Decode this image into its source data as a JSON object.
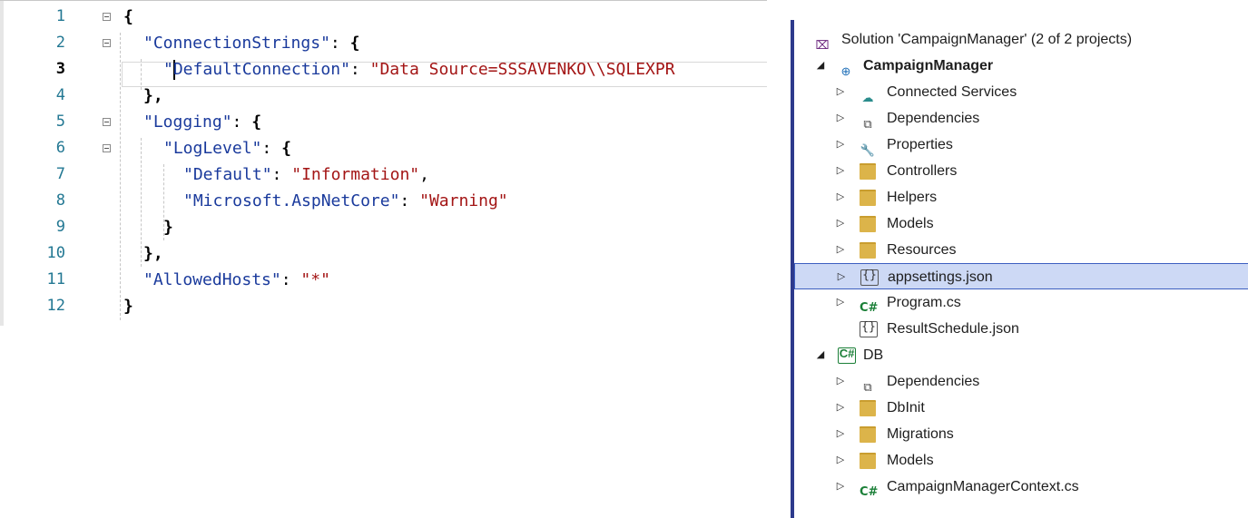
{
  "editor": {
    "lines": [
      {
        "num": "1",
        "tokens": [
          {
            "t": "{",
            "c": "b"
          }
        ]
      },
      {
        "num": "2",
        "tokens": [
          {
            "t": "\"ConnectionStrings\"",
            "c": "k"
          },
          {
            "t": ": ",
            "c": "p"
          },
          {
            "t": "{",
            "c": "b"
          }
        ]
      },
      {
        "num": "3",
        "tokens": [
          {
            "t": "\"",
            "c": "k"
          },
          {
            "t": "|caret|",
            "c": "caret"
          },
          {
            "t": "DefaultConnection\"",
            "c": "k"
          },
          {
            "t": ": ",
            "c": "p"
          },
          {
            "t": "\"Data Source=SSSAVENKO\\\\SQLEXPR",
            "c": "s"
          }
        ]
      },
      {
        "num": "4",
        "tokens": [
          {
            "t": "},",
            "c": "b"
          }
        ]
      },
      {
        "num": "5",
        "tokens": [
          {
            "t": "\"Logging\"",
            "c": "k"
          },
          {
            "t": ": ",
            "c": "p"
          },
          {
            "t": "{",
            "c": "b"
          }
        ]
      },
      {
        "num": "6",
        "tokens": [
          {
            "t": "\"LogLevel\"",
            "c": "k"
          },
          {
            "t": ": ",
            "c": "p"
          },
          {
            "t": "{",
            "c": "b"
          }
        ]
      },
      {
        "num": "7",
        "tokens": [
          {
            "t": "\"Default\"",
            "c": "k"
          },
          {
            "t": ": ",
            "c": "p"
          },
          {
            "t": "\"Information\"",
            "c": "s"
          },
          {
            "t": ",",
            "c": "p"
          }
        ]
      },
      {
        "num": "8",
        "tokens": [
          {
            "t": "\"Microsoft.AspNetCore\"",
            "c": "k"
          },
          {
            "t": ": ",
            "c": "p"
          },
          {
            "t": "\"Warning\"",
            "c": "s"
          }
        ]
      },
      {
        "num": "9",
        "tokens": [
          {
            "t": "}",
            "c": "b"
          }
        ]
      },
      {
        "num": "10",
        "tokens": [
          {
            "t": "},",
            "c": "b"
          }
        ]
      },
      {
        "num": "11",
        "tokens": [
          {
            "t": "\"AllowedHosts\"",
            "c": "k"
          },
          {
            "t": ": ",
            "c": "p"
          },
          {
            "t": "\"*\"",
            "c": "s"
          }
        ]
      },
      {
        "num": "12",
        "tokens": [
          {
            "t": "}",
            "c": "b"
          }
        ]
      }
    ],
    "active_line": "3"
  },
  "explorer": {
    "items": [
      {
        "label": "Solution 'CampaignManager' (2 of 2 projects)",
        "icon": "solution-icon",
        "arrow": "",
        "bold": false,
        "selected": false
      },
      {
        "label": "CampaignManager",
        "icon": "web-project-icon",
        "arrow": "expanded",
        "bold": true,
        "selected": false
      },
      {
        "label": "Connected Services",
        "icon": "connected-services-icon",
        "arrow": "collapsed",
        "bold": false,
        "selected": false
      },
      {
        "label": "Dependencies",
        "icon": "dependencies-icon",
        "arrow": "collapsed",
        "bold": false,
        "selected": false
      },
      {
        "label": "Properties",
        "icon": "properties-icon",
        "arrow": "collapsed",
        "bold": false,
        "selected": false
      },
      {
        "label": "Controllers",
        "icon": "folder-icon",
        "arrow": "collapsed",
        "bold": false,
        "selected": false
      },
      {
        "label": "Helpers",
        "icon": "folder-icon",
        "arrow": "collapsed",
        "bold": false,
        "selected": false
      },
      {
        "label": "Models",
        "icon": "folder-icon",
        "arrow": "collapsed",
        "bold": false,
        "selected": false
      },
      {
        "label": "Resources",
        "icon": "folder-icon",
        "arrow": "collapsed",
        "bold": false,
        "selected": false
      },
      {
        "label": "appsettings.json",
        "icon": "json-file-icon",
        "arrow": "collapsed",
        "bold": false,
        "selected": true
      },
      {
        "label": "Program.cs",
        "icon": "csharp-file-icon",
        "arrow": "collapsed",
        "bold": false,
        "selected": false
      },
      {
        "label": "ResultSchedule.json",
        "icon": "json-file-icon",
        "arrow": "",
        "bold": false,
        "selected": false
      },
      {
        "label": "DB",
        "icon": "csharp-project-icon",
        "arrow": "expanded",
        "bold": false,
        "selected": false
      },
      {
        "label": "Dependencies",
        "icon": "dependencies-icon",
        "arrow": "collapsed",
        "bold": false,
        "selected": false
      },
      {
        "label": "DbInit",
        "icon": "folder-icon",
        "arrow": "collapsed",
        "bold": false,
        "selected": false
      },
      {
        "label": "Migrations",
        "icon": "folder-icon",
        "arrow": "collapsed",
        "bold": false,
        "selected": false
      },
      {
        "label": "Models",
        "icon": "folder-icon",
        "arrow": "collapsed",
        "bold": false,
        "selected": false
      },
      {
        "label": "CampaignManagerContext.cs",
        "icon": "csharp-file-icon",
        "arrow": "collapsed",
        "bold": false,
        "selected": false
      }
    ]
  },
  "colors": {
    "keyword": "#1a3a9c",
    "string": "#a31515",
    "line_number": "#237893",
    "selection_bg": "#cdd9f5",
    "selection_border": "#3d5fc0",
    "folder": "#dcb44a",
    "csharp": "#1a7f37",
    "accent_bar": "#2d3a8c"
  }
}
